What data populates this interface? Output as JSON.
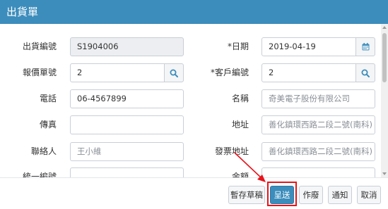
{
  "dialog": {
    "title": "出貨單"
  },
  "form": {
    "shipment_no": {
      "label": "出貨編號",
      "value": "S1904006"
    },
    "date": {
      "label": "*日期",
      "value": "2019-04-19"
    },
    "quote_no": {
      "label": "報價單號",
      "value": "2"
    },
    "customer_no": {
      "label": "*客戶編號",
      "value": "2"
    },
    "phone": {
      "label": "電話",
      "value": "06-4567899"
    },
    "name": {
      "label": "名稱",
      "placeholder": "奇美電子股份有限公司"
    },
    "fax": {
      "label": "傳真",
      "value": ""
    },
    "address": {
      "label": "地址",
      "placeholder": "善化鎮環西路二段二號(南科)"
    },
    "contact": {
      "label": "聯絡人",
      "placeholder": "王小維"
    },
    "invoice_address": {
      "label": "發票地址",
      "placeholder": "善化鎮環西路二段二號(南科)"
    },
    "tax_id": {
      "label": "統一編號"
    },
    "amount": {
      "label": "金額"
    }
  },
  "footer": {
    "save_draft": "暫存草稿",
    "submit": "呈送",
    "void": "作廢",
    "notify": "通知",
    "cancel": "取消"
  },
  "colors": {
    "header": "#3c8dbc",
    "highlight": "#e8141b"
  }
}
